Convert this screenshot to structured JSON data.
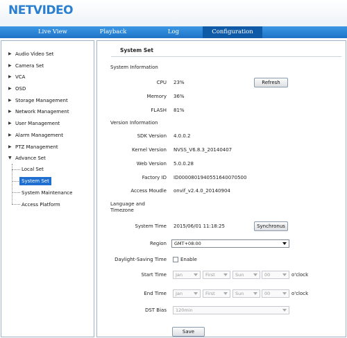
{
  "header": {
    "logo": "NETVIDEO"
  },
  "nav": [
    {
      "label": "Live View"
    },
    {
      "label": "Playback"
    },
    {
      "label": "Log"
    },
    {
      "label": "Configuration"
    }
  ],
  "sidebar": {
    "items": [
      {
        "label": "Audio Video Set"
      },
      {
        "label": "Camera Set"
      },
      {
        "label": "VCA"
      },
      {
        "label": "OSD"
      },
      {
        "label": "Storage Management"
      },
      {
        "label": "Network Management"
      },
      {
        "label": "User Management"
      },
      {
        "label": "Alarm Management"
      },
      {
        "label": "PTZ Management"
      },
      {
        "label": "Advance Set"
      }
    ],
    "sub_items": [
      {
        "label": "Local Set"
      },
      {
        "label": "System Set"
      },
      {
        "label": "System Maintenance"
      },
      {
        "label": "Access Platform"
      }
    ],
    "selected": "System Set"
  },
  "page": {
    "title": "System Set",
    "sections": {
      "system_info": "System Information",
      "version_info": "Version Information",
      "language_timezone": "Language and Timezone"
    },
    "cpu": {
      "label": "CPU",
      "value": "23%"
    },
    "memory": {
      "label": "Memory",
      "value": "36%"
    },
    "flash": {
      "label": "FLASH",
      "value": "81%"
    },
    "refresh_label": "Refresh",
    "sdk": {
      "label": "SDK Version",
      "value": "4.0.0.2"
    },
    "kernel": {
      "label": "Kernel Version",
      "value": "NVSS_V6.8.3_20140407"
    },
    "web": {
      "label": "Web Version",
      "value": "5.0.0.28"
    },
    "factory": {
      "label": "Factory ID",
      "value": "ID0000801940551640070500"
    },
    "access_module": {
      "label": "Access Moudle",
      "value": "onvif_v2.4.0_20140904"
    },
    "system_time": {
      "label": "System Time",
      "value": "2015/06/01 11:18:25"
    },
    "synchronous_label": "Synchronus",
    "region": {
      "label": "Region",
      "value": "GMT+08:00"
    },
    "dst": {
      "label": "Daylight-Saving Time",
      "enable_label": "Enable",
      "enabled": false
    },
    "start_time": {
      "label": "Start Time",
      "month": "Jan",
      "week": "First",
      "day": "Sun",
      "hour": "00",
      "suffix": "o'clock"
    },
    "end_time": {
      "label": "End Time",
      "month": "Jan",
      "week": "First",
      "day": "Sun",
      "hour": "00",
      "suffix": "o'clock"
    },
    "dst_bias": {
      "label": "DST Bias",
      "value": "120min"
    },
    "save_label": "Save"
  },
  "colors": {
    "brand": "#2a7fd0",
    "nav_bar": "#1f73c6",
    "nav_active": "#0e5aa6",
    "selected": "#1e6fd0"
  }
}
